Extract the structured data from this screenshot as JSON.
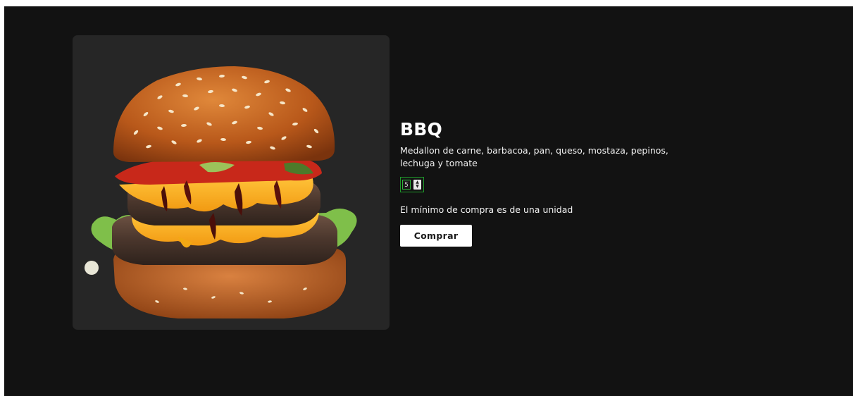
{
  "product": {
    "name": "BBQ",
    "description": "Medallon de carne, barbacoa, pan, queso, mostaza, pepinos, lechuga y tomate",
    "image_icon": "burger-image",
    "quantity": {
      "value": "5",
      "border_color": "#1f9a2a"
    },
    "min_note": "El mínimo de compra es de una unidad",
    "buy_label": "Comprar"
  },
  "colors": {
    "page_background": "#121212",
    "card_background": "#262626",
    "text": "#ffffff",
    "button_background": "#ffffff"
  }
}
